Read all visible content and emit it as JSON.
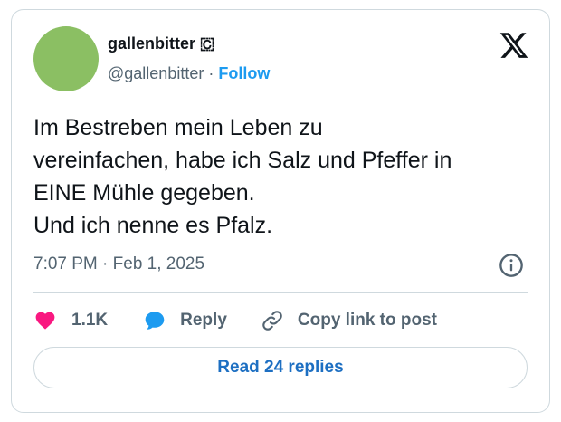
{
  "author": {
    "display_name": "gallenbitter 🇨",
    "handle": "@gallenbitter",
    "separator": "·",
    "follow_label": "Follow"
  },
  "tweet": {
    "lines": [
      "Im Bestreben mein Leben zu",
      "vereinfachen, habe ich Salz und Pfeffer in",
      "EINE Mühle gegeben.",
      "Und ich nenne es Pfalz."
    ],
    "timestamp": "7:07 PM · Feb 1, 2025"
  },
  "actions": {
    "like_count": "1.1K",
    "reply_label": "Reply",
    "copy_link_label": "Copy link to post"
  },
  "read_replies_label": "Read 24 replies",
  "colors": {
    "accent": "#1d9bf0",
    "heart": "#f91880",
    "reply_bubble": "#1d9bf0",
    "avatar": "#8bbf63"
  },
  "icons": [
    "x-logo-icon",
    "info-icon",
    "heart-icon",
    "reply-bubble-icon",
    "link-icon"
  ]
}
